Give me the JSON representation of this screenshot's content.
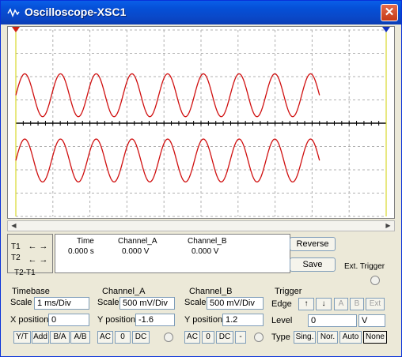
{
  "window": {
    "title": "Oscilloscope-XSC1",
    "close_label": "✕"
  },
  "colors": {
    "trace": "#D01010",
    "grid": "#B0B0B0",
    "cursor1": "#D02010",
    "cursor2": "#1030C0"
  },
  "chart_data": {
    "type": "line",
    "series": [
      {
        "name": "Channel_A",
        "cycles": 8.5,
        "amplitude_div": 1.0,
        "y_position_div": -1.6
      },
      {
        "name": "Channel_B",
        "cycles": 8.5,
        "amplitude_div": 1.0,
        "y_position_div": 1.2
      }
    ],
    "grid": true,
    "x_divisions": 10,
    "y_divisions": 8
  },
  "cursors": {
    "t1_label": "T1",
    "t2_label": "T2",
    "diff_label": "T2-T1",
    "left_arrow": "🡄",
    "right_arrow": "🡆"
  },
  "readout": {
    "headers": [
      "Time",
      "Channel_A",
      "Channel_B"
    ],
    "values": [
      "0.000 s",
      "0.000 V",
      "0.000 V"
    ]
  },
  "buttons": {
    "reverse": "Reverse",
    "save": "Save",
    "ext_trigger": "Ext. Trigger"
  },
  "timebase": {
    "title": "Timebase",
    "scale_label": "Scale",
    "scale_value": "1 ms/Div",
    "xpos_label": "X position",
    "xpos_value": "0",
    "modes": [
      "Y/T",
      "Add",
      "B/A",
      "A/B"
    ]
  },
  "channel_a": {
    "title": "Channel_A",
    "scale_label": "Scale",
    "scale_value": "500 mV/Div",
    "ypos_label": "Y position",
    "ypos_value": "-1.6",
    "coupling": [
      "AC",
      "0",
      "DC"
    ]
  },
  "channel_b": {
    "title": "Channel_B",
    "scale_label": "Scale",
    "scale_value": "500 mV/Div",
    "ypos_label": "Y position",
    "ypos_value": "1.2",
    "coupling": [
      "AC",
      "0",
      "DC",
      "-"
    ]
  },
  "trigger": {
    "title": "Trigger",
    "edge_label": "Edge",
    "level_label": "Level",
    "level_value": "0",
    "level_unit": "V",
    "edge_buttons": [
      "↑",
      "↓",
      "A",
      "B",
      "Ext"
    ],
    "type_label": "Type",
    "types": [
      "Sing.",
      "Nor.",
      "Auto",
      "None"
    ]
  }
}
